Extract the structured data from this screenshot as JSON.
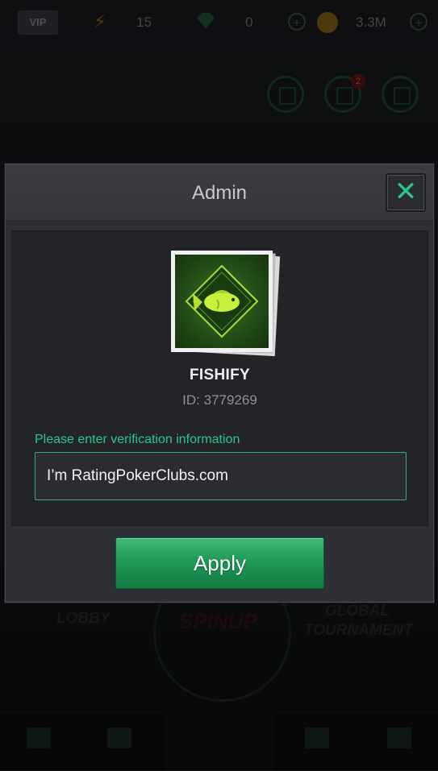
{
  "background": {
    "vip_label": "VIP",
    "energy_count": "15",
    "gem_count": "0",
    "coin_balance": "3.3M",
    "mail_badge_count": "2",
    "lobby_label": "LOBBY",
    "spinup_label": "SPINUP",
    "global_tournament_label": "GLOBAL TOURNAMENT"
  },
  "dialog": {
    "title": "Admin",
    "close_glyph": "✕",
    "profile": {
      "name": "FISHIFY",
      "id_text": "ID: 3779269",
      "avatar_icon": "fish-diamond-icon"
    },
    "verification": {
      "label": "Please enter verification information",
      "value": "I’m RatingPokerClubs.com"
    },
    "apply_label": "Apply"
  },
  "colors": {
    "accent_green": "#2ec58b",
    "button_green": "#1f9a59",
    "dialog_bg": "#2f3035",
    "panel_bg": "#232428"
  }
}
